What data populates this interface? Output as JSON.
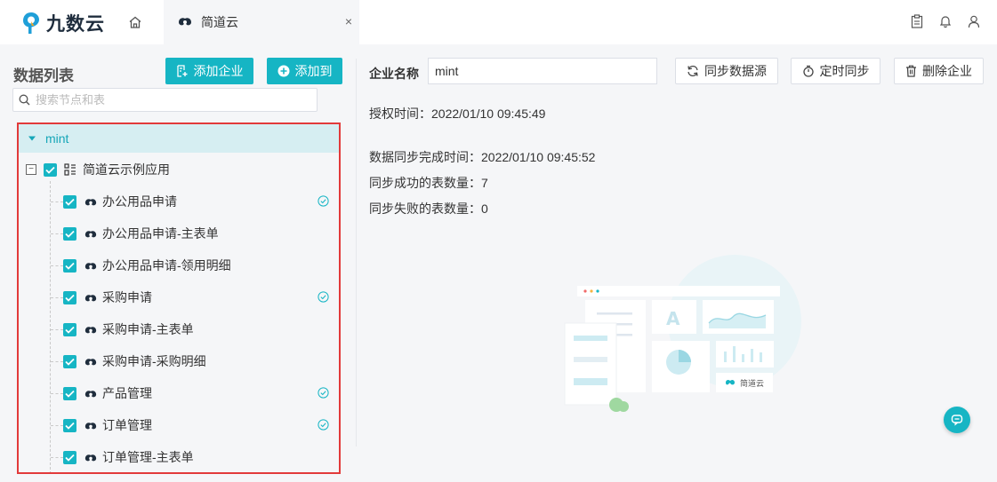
{
  "header": {
    "logo_text": "九数云",
    "tab": {
      "label": "简道云",
      "close": "×"
    }
  },
  "sidebar": {
    "title": "数据列表",
    "add_enterprise_label": "添加企业",
    "add_to_label": "添加到",
    "search_placeholder": "搜索节点和表",
    "tree": {
      "root": "mint",
      "app": "简道云示例应用",
      "items": [
        {
          "label": "办公用品申请",
          "synced": true
        },
        {
          "label": "办公用品申请-主表单",
          "synced": false
        },
        {
          "label": "办公用品申请-领用明细",
          "synced": false
        },
        {
          "label": "采购申请",
          "synced": true
        },
        {
          "label": "采购申请-主表单",
          "synced": false
        },
        {
          "label": "采购申请-采购明细",
          "synced": false
        },
        {
          "label": "产品管理",
          "synced": true
        },
        {
          "label": "订单管理",
          "synced": true
        },
        {
          "label": "订单管理-主表单",
          "synced": false
        }
      ]
    }
  },
  "main": {
    "enterprise_label": "企业名称",
    "enterprise_value": "mint",
    "sync_source_label": "同步数据源",
    "timed_sync_label": "定时同步",
    "delete_enterprise_label": "删除企业",
    "auth_time": "授权时间：2022/01/10 09:45:49",
    "sync_done_time": "数据同步完成时间：2022/01/10 09:45:52",
    "sync_success": "同步成功的表数量：7",
    "sync_fail": "同步失败的表数量：0",
    "illustration_letter": "A",
    "illustration_brand": "简道云"
  },
  "colors": {
    "accent": "#16b5c4",
    "highlight_border": "#e23a3a",
    "selected_row": "#d6eef2"
  }
}
